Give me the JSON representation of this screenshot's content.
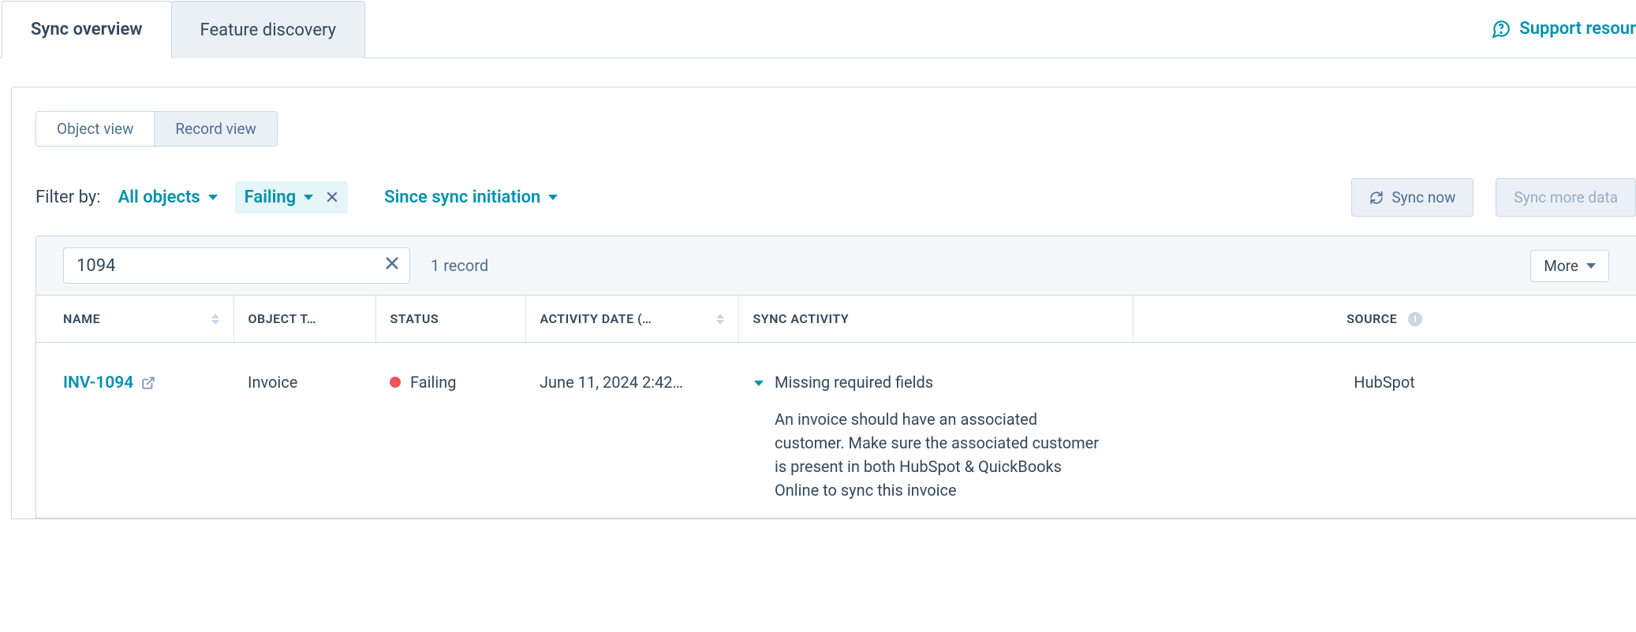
{
  "tabs": {
    "overview": "Sync overview",
    "discovery": "Feature discovery"
  },
  "support_link": "Support resour",
  "view_toggle": {
    "object": "Object view",
    "record": "Record view"
  },
  "filter_label": "Filter by:",
  "filters": {
    "objects": "All objects",
    "status": "Failing",
    "date": "Since sync initiation"
  },
  "buttons": {
    "sync_now": "Sync now",
    "sync_more": "Sync more data",
    "more": "More"
  },
  "search": {
    "value": "1094"
  },
  "record_count": "1 record",
  "columns": {
    "name": "Name",
    "object_type": "Object t…",
    "status": "Status",
    "activity_date": "Activity date (…",
    "sync_activity": "Sync activity",
    "source": "Source"
  },
  "row": {
    "name": "INV-1094",
    "object_type": "Invoice",
    "status": "Failing",
    "activity_date": "June 11, 2024 2:42…",
    "sync_title": "Missing required fields",
    "sync_desc": "An invoice should have an associated customer. Make sure the associated customer is present in both HubSpot & QuickBooks Online to sync this invoice",
    "source": "HubSpot"
  }
}
